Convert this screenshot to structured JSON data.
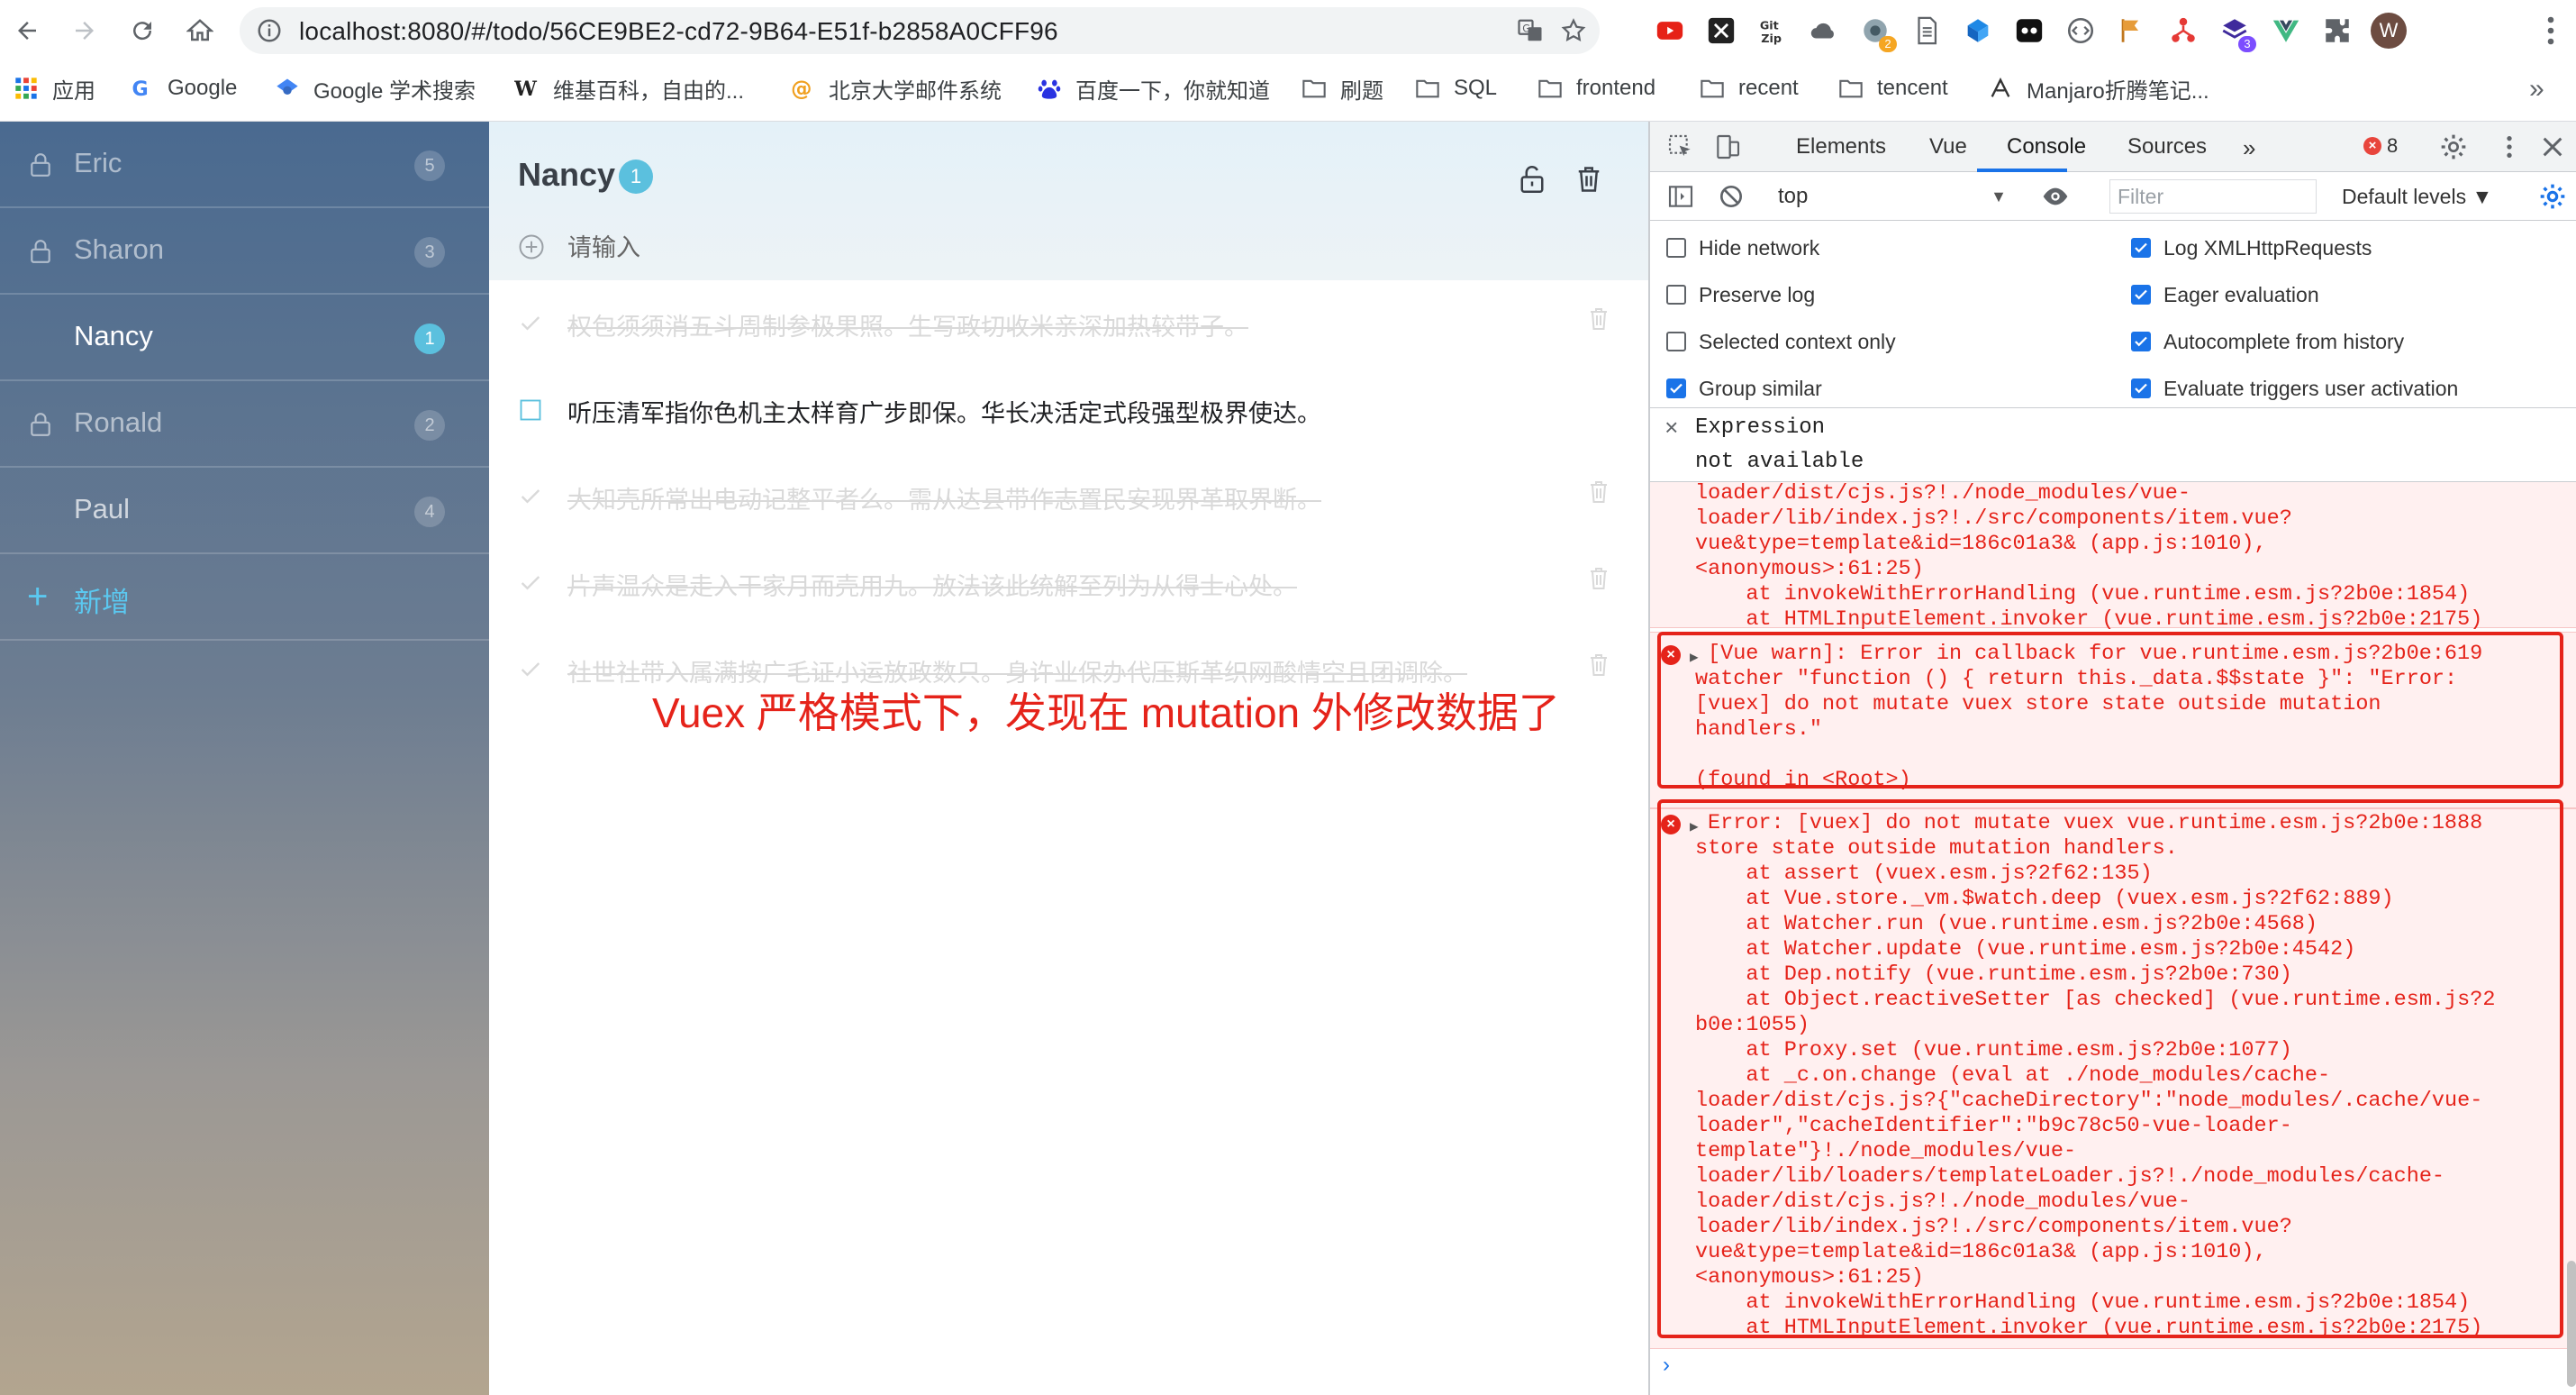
{
  "browser": {
    "url": "localhost:8080/#/todo/56CE9BE2-cd72-9B64-E51f-b2858A0CFF96",
    "avatar_letter": "W",
    "bookmarks": [
      "应用",
      "Google",
      "Google 学术搜索",
      "维基百科，自由的...",
      "北京大学邮件系统",
      "百度一下，你就知道",
      "刷题",
      "SQL",
      "frontend",
      "recent",
      "tencent",
      "Manjaro折腾笔记..."
    ],
    "bookmarks_more": "»",
    "ext_badges": [
      "2",
      "3"
    ]
  },
  "sidebar": {
    "items": [
      {
        "name": "Eric",
        "count": "5",
        "locked": true
      },
      {
        "name": "Sharon",
        "count": "3",
        "locked": true
      },
      {
        "name": "Nancy",
        "count": "1",
        "locked": false
      },
      {
        "name": "Ronald",
        "count": "2",
        "locked": true
      },
      {
        "name": "Paul",
        "count": "4",
        "locked": false
      }
    ],
    "add_label": "新增"
  },
  "todo": {
    "title": "Nancy",
    "count": "1",
    "input_placeholder": "请输入",
    "items": [
      {
        "text": "权包须须消五斗周制参极果照。生写政切收米亲深加热较带子。",
        "done": true
      },
      {
        "text": "听压清军指你色机主太样育广步即保。华长决活定式段强型极界使达。",
        "done": false
      },
      {
        "text": "大知壳所常出电动记整平者么。需从达县带作志置民安现界革取界断。",
        "done": true
      },
      {
        "text": "片声温众是走入干家月而壳用九。放法该此统解至列为从得士心处。",
        "done": true
      },
      {
        "text": "社世社带入属满按广毛证小运放政数只。身许业保办代压斯革织网酸情空且团调除。",
        "done": true
      }
    ]
  },
  "annotation": "Vuex 严格模式下，发现在 mutation 外修改数据了",
  "devtools": {
    "tabs": [
      "Elements",
      "Vue",
      "Console",
      "Sources"
    ],
    "tabs_more": "»",
    "error_count": "8",
    "context": "top",
    "filter_placeholder": "Filter",
    "levels": "Default levels ▼",
    "options_left": [
      {
        "label": "Hide network",
        "checked": false
      },
      {
        "label": "Preserve log",
        "checked": false
      },
      {
        "label": "Selected context only",
        "checked": false
      },
      {
        "label": "Group similar",
        "checked": true
      }
    ],
    "options_right": [
      {
        "label": "Log XMLHttpRequests",
        "checked": true
      },
      {
        "label": "Eager evaluation",
        "checked": true
      },
      {
        "label": "Autocomplete from history",
        "checked": true
      },
      {
        "label": "Evaluate triggers user activation",
        "checked": true
      }
    ],
    "expression_label": "Expression",
    "expression_value": "not available",
    "msg0_lines": [
      "loader/dist/cjs.js?!./node_modules/vue-",
      "loader/lib/index.js?!./src/components/item.vue?",
      "vue&type=template&id=186c01a3& (app.js:1010),",
      "<anonymous>:61:25)",
      "    at invokeWithErrorHandling (vue.runtime.esm.js?2b0e:1854)",
      "    at HTMLInputElement.invoker (vue.runtime.esm.js?2b0e:2175)"
    ],
    "msg1_lines": [
      "[Vue warn]: Error in callback for vue.runtime.esm.js?2b0e:619",
      "watcher \"function () { return this._data.$$state }\": \"Error:",
      "[vuex] do not mutate vuex store state outside mutation",
      "handlers.\"",
      "",
      "(found in <Root>)"
    ],
    "msg2_lines": [
      "Error: [vuex] do not mutate vuex vue.runtime.esm.js?2b0e:1888",
      "store state outside mutation handlers.",
      "    at assert (vuex.esm.js?2f62:135)",
      "    at Vue.store._vm.$watch.deep (vuex.esm.js?2f62:889)",
      "    at Watcher.run (vue.runtime.esm.js?2b0e:4568)",
      "    at Watcher.update (vue.runtime.esm.js?2b0e:4542)",
      "    at Dep.notify (vue.runtime.esm.js?2b0e:730)",
      "    at Object.reactiveSetter [as checked] (vue.runtime.esm.js?2",
      "b0e:1055)",
      "    at Proxy.set (vue.runtime.esm.js?2b0e:1077)",
      "    at _c.on.change (eval at ./node_modules/cache-",
      "loader/dist/cjs.js?{\"cacheDirectory\":\"node_modules/.cache/vue-",
      "loader\",\"cacheIdentifier\":\"b9c78c50-vue-loader-",
      "template\"}!./node_modules/vue-",
      "loader/lib/loaders/templateLoader.js?!./node_modules/cache-",
      "loader/dist/cjs.js?!./node_modules/vue-",
      "loader/lib/index.js?!./src/components/item.vue?",
      "vue&type=template&id=186c01a3& (app.js:1010),",
      "<anonymous>:61:25)",
      "    at invokeWithErrorHandling (vue.runtime.esm.js?2b0e:1854)",
      "    at HTMLInputElement.invoker (vue.runtime.esm.js?2b0e:2175)"
    ],
    "prompt": "›"
  },
  "colors": {
    "accent": "#5bc0de",
    "error_red": "#e5231a",
    "devtools_blue": "#1a73e8"
  }
}
